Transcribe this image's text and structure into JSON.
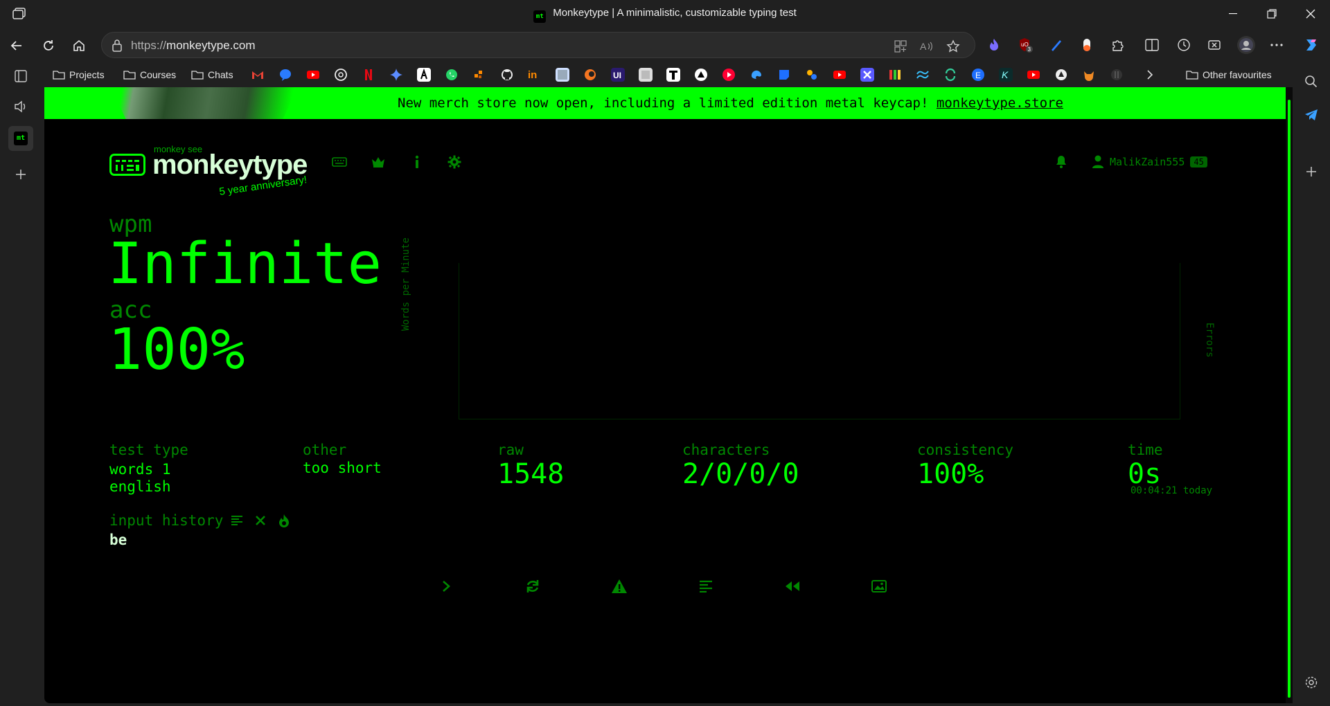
{
  "window": {
    "title": "Monkeytype | A minimalistic, customizable typing test",
    "favicon_text": "mt"
  },
  "address_bar": {
    "url_prefix": "https://",
    "url_host": "monkeytype.com"
  },
  "extensions": {
    "ublock_badge": "3"
  },
  "favorites": {
    "folders": [
      "Projects",
      "Courses",
      "Chats"
    ],
    "other_favourites": "Other favourites"
  },
  "banner": {
    "text": "New merch store now open, including a limited edition metal keycap!",
    "link": "monkeytype.store"
  },
  "logo": {
    "top_text": "monkey see",
    "wordmark": "monkeytype",
    "anniversary": "5 year anniversary!"
  },
  "user": {
    "name": "MalikZain555",
    "level": "45"
  },
  "result": {
    "wpm_label": "wpm",
    "wpm_value": "Infinite",
    "acc_label": "acc",
    "acc_value": "100%",
    "chart_y_label": "Words per Minute",
    "chart_y2_label": "Errors",
    "test_type_label": "test type",
    "test_type_line1": "words 1",
    "test_type_line2": "english",
    "other_label": "other",
    "other_value": "too short",
    "raw_label": "raw",
    "raw_value": "1548",
    "characters_label": "characters",
    "characters_value": "2/0/0/0",
    "consistency_label": "consistency",
    "consistency_value": "100%",
    "time_label": "time",
    "time_value": "0s",
    "time_sub": "00:04:21 today",
    "input_history_label": "input history",
    "input_history_words": "be"
  },
  "colors": {
    "main": "#00ff00",
    "sub": "#008800",
    "bg": "#000000"
  }
}
